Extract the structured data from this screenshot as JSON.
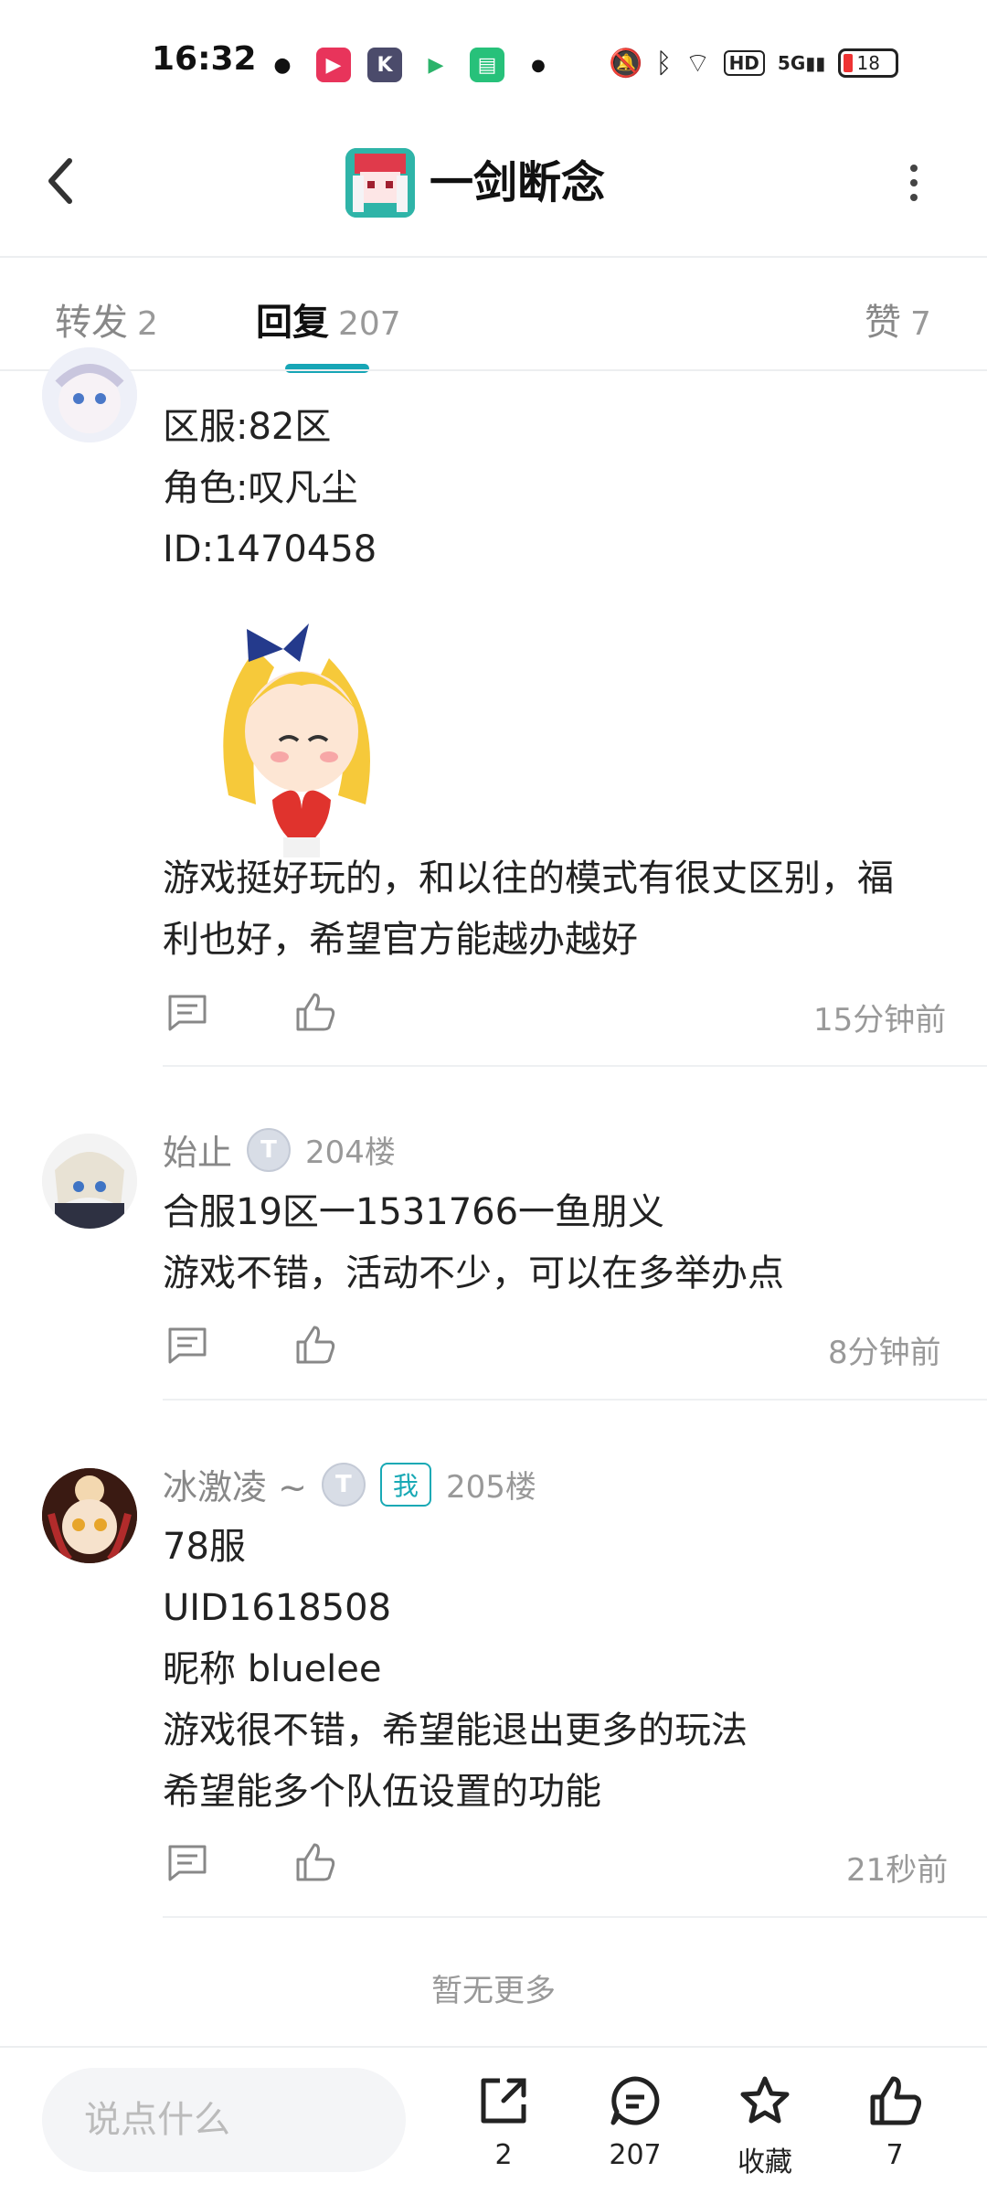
{
  "status": {
    "time": "16:32",
    "battery": "18",
    "network": "5G",
    "hd": "HD"
  },
  "header": {
    "title": "一剑断念"
  },
  "tabs": [
    {
      "label": "转发",
      "count": "2"
    },
    {
      "label": "回复",
      "count": "207"
    },
    {
      "label": "赞",
      "count": "7"
    }
  ],
  "comments": [
    {
      "lines": [
        "区服:82区",
        "角色:叹凡尘",
        "ID:1470458"
      ],
      "text2": [
        "游戏挺好玩的，和以往的模式有很丈区别，福",
        "利也好，希望官方能越办越好"
      ],
      "time": "15分钟前"
    },
    {
      "name": "始止",
      "floor": "204楼",
      "lines": [
        "合服19区一1531766一鱼朋义",
        "游戏不错，活动不少，可以在多举办点"
      ],
      "time": "8分钟前"
    },
    {
      "name": "冰激凌 ~",
      "me": "我",
      "floor": "205楼",
      "lines": [
        "78服",
        "UID1618508",
        "昵称 bluelee",
        "游戏很不错，希望能退出更多的玩法",
        "希望能多个队伍设置的功能"
      ],
      "time": "21秒前"
    }
  ],
  "footer": {
    "no_more": "暂无更多",
    "input_placeholder": "说点什么",
    "share_count": "2",
    "comment_count": "207",
    "favorite_label": "收藏",
    "like_count": "7"
  },
  "colors": {
    "accent": "#17a6b6"
  }
}
